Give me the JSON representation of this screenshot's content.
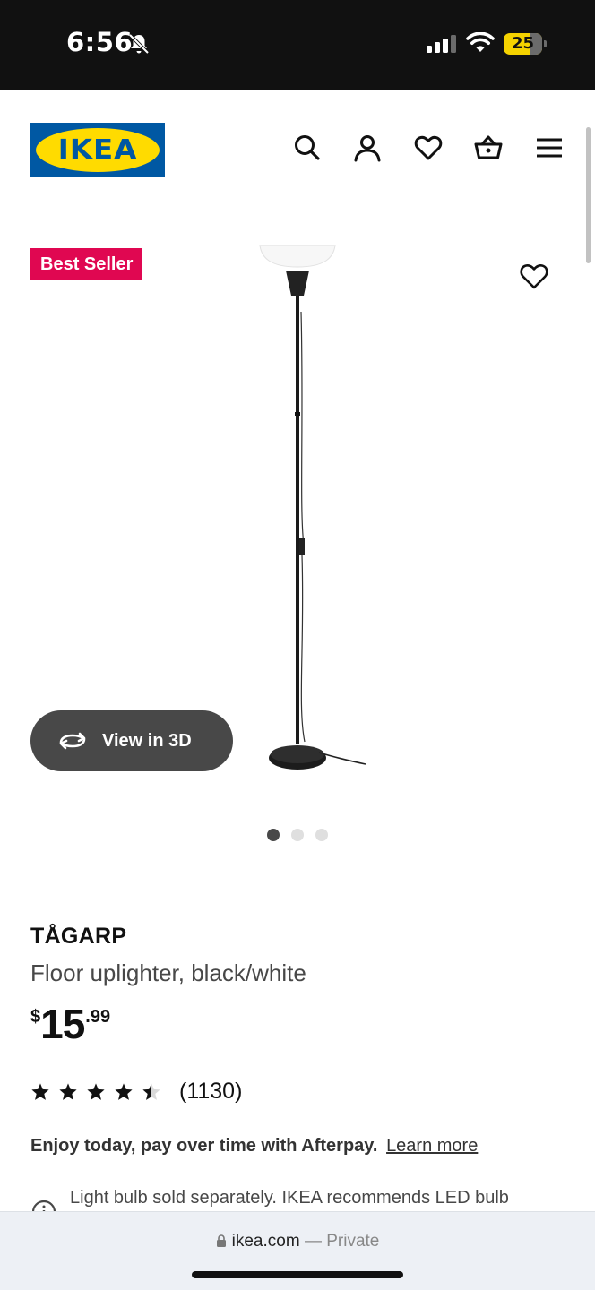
{
  "status_bar": {
    "time": "6:56",
    "battery": "25",
    "icons": [
      "bell-off-icon",
      "signal-icon",
      "wifi-icon",
      "battery-icon"
    ]
  },
  "header": {
    "logo_text": "IKEA",
    "icons": [
      "search-icon",
      "account-icon",
      "heart-icon",
      "basket-icon",
      "menu-icon"
    ]
  },
  "media": {
    "badge": "Best Seller",
    "view_3d_label": "View in 3D",
    "image_count": 3,
    "active_image": 1
  },
  "product": {
    "name": "TÅGARP",
    "description": "Floor uplighter, black/white",
    "price": {
      "currency": "$",
      "integer": "15",
      "decimal": ".99"
    },
    "rating": {
      "stars": 4.5,
      "max": 5,
      "count": "(1130)"
    },
    "afterpay_text": "Enjoy today, pay over time with Afterpay.",
    "afterpay_link": "Learn more",
    "notice": "Light bulb sold separately. IKEA recommends LED bulb"
  },
  "browser": {
    "domain": "ikea.com",
    "separator": "—",
    "mode": "Private"
  },
  "colors": {
    "ikea_blue": "#0058a3",
    "ikea_yellow": "#ffdb00",
    "badge_red": "#e00751",
    "battery_yellow": "#f5d200"
  }
}
